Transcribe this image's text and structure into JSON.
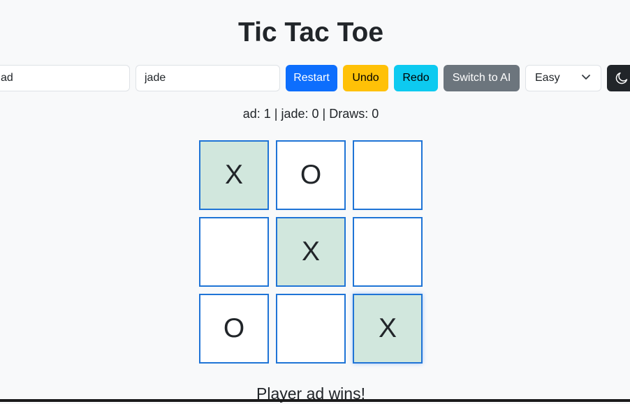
{
  "title": "Tic Tac Toe",
  "controls": {
    "player1_name": "ad",
    "player2_name": "jade",
    "restart_label": "Restart",
    "undo_label": "Undo",
    "redo_label": "Redo",
    "switch_label": "Switch to AI",
    "difficulty": "Easy",
    "theme_toggle_icon": "moon-icon"
  },
  "score": {
    "text": "ad: 1 | jade: 0 | Draws: 0"
  },
  "board": {
    "cells": [
      "X",
      "O",
      "",
      "",
      "X",
      "",
      "O",
      "",
      "X"
    ],
    "winning_cells": [
      0,
      4,
      8
    ]
  },
  "status": "Player ad wins!",
  "colors": {
    "cell_border": "#1f74d6",
    "win_highlight": "#d1e7dd",
    "restart": "#0d6efd",
    "undo": "#ffc107",
    "redo": "#0dcaf0",
    "switch": "#6c757d",
    "theme_button": "#212529"
  }
}
